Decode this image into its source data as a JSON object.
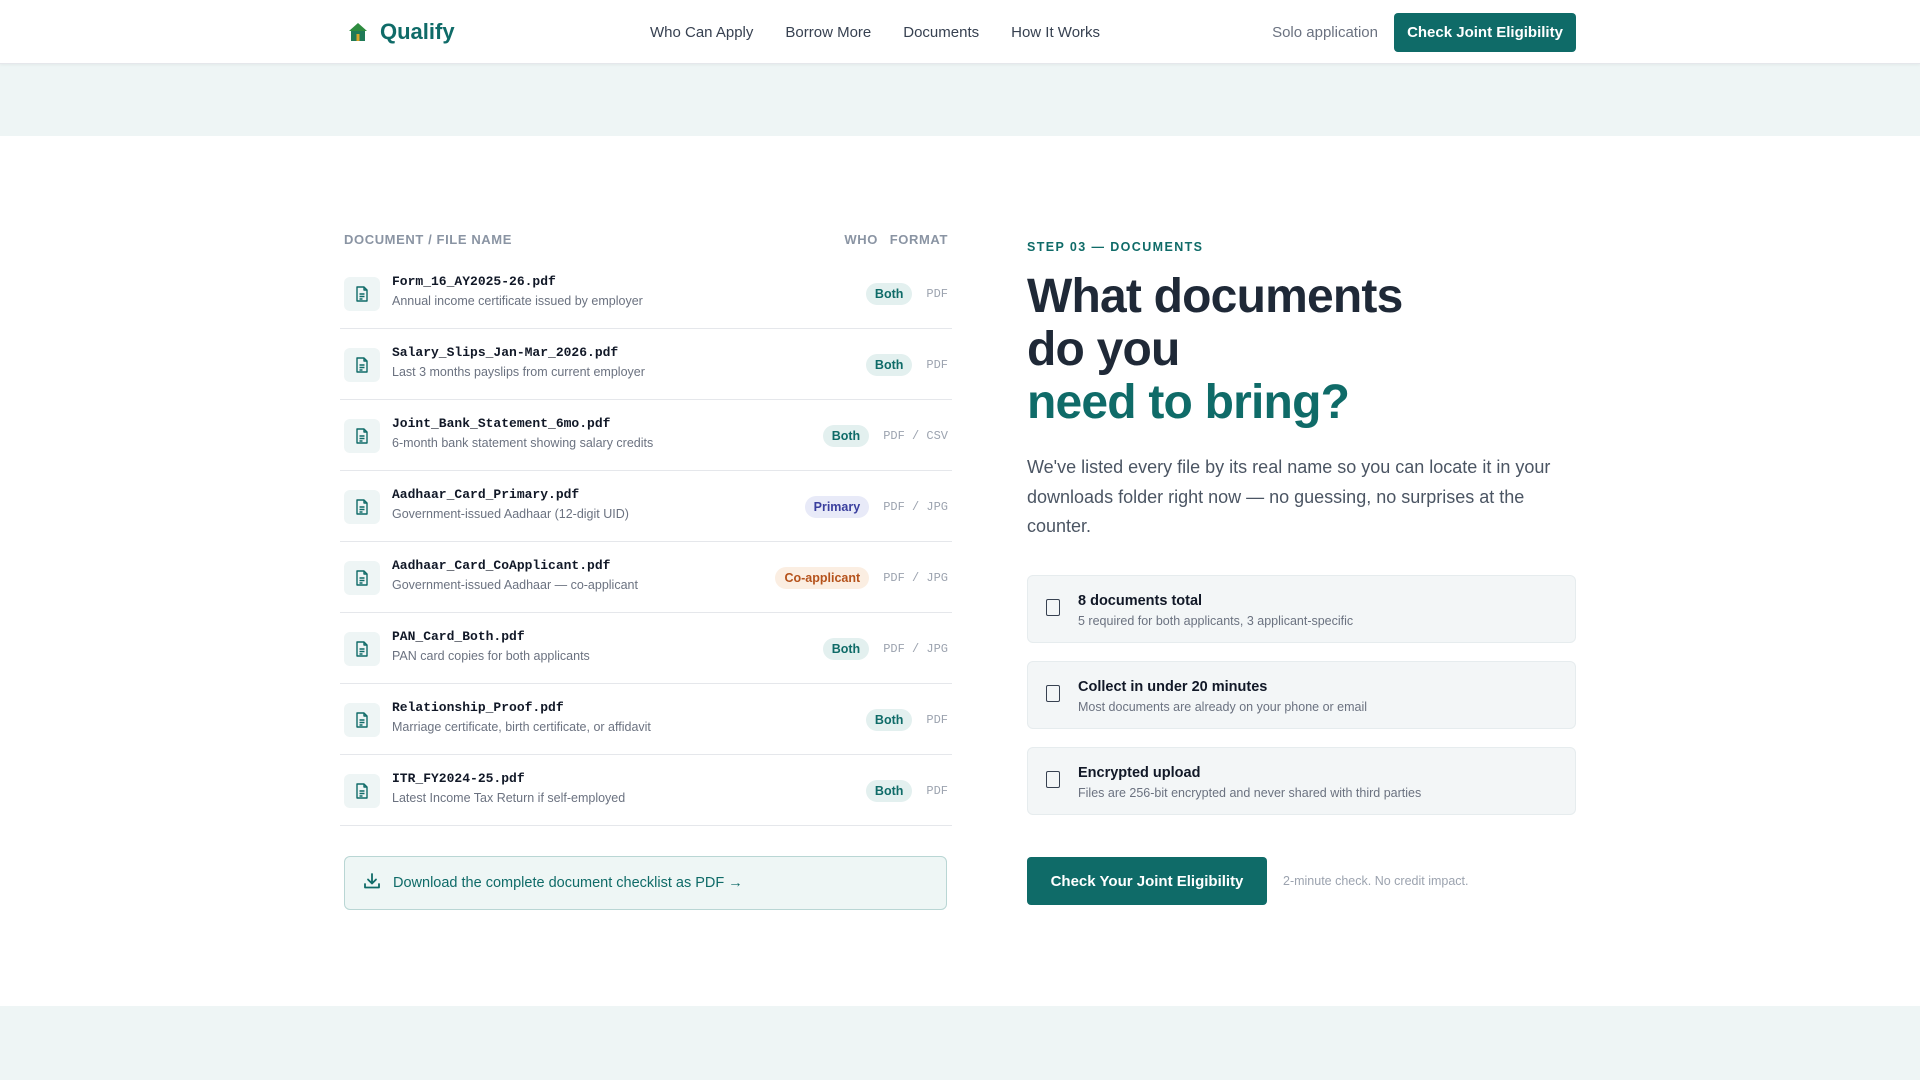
{
  "nav": {
    "brand": "Qualify",
    "links": [
      "Who Can Apply",
      "Borrow More",
      "Documents",
      "How It Works"
    ],
    "solo": "Solo application",
    "cta": "Check Joint Eligibility"
  },
  "table": {
    "headers": {
      "doc": "DOCUMENT / FILE NAME",
      "who": "WHO",
      "format": "FORMAT"
    },
    "rows": [
      {
        "file": "Form_16_AY2025-26.pdf",
        "desc": "Annual income certificate issued by employer",
        "who": "Both",
        "format": "PDF"
      },
      {
        "file": "Salary_Slips_Jan-Mar_2026.pdf",
        "desc": "Last 3 months payslips from current employer",
        "who": "Both",
        "format": "PDF"
      },
      {
        "file": "Joint_Bank_Statement_6mo.pdf",
        "desc": "6-month bank statement showing salary credits",
        "who": "Both",
        "format": "PDF / CSV"
      },
      {
        "file": "Aadhaar_Card_Primary.pdf",
        "desc": "Government-issued Aadhaar (12-digit UID)",
        "who": "Primary",
        "format": "PDF / JPG"
      },
      {
        "file": "Aadhaar_Card_CoApplicant.pdf",
        "desc": "Government-issued Aadhaar — co-applicant",
        "who": "Co-applicant",
        "format": "PDF / JPG"
      },
      {
        "file": "PAN_Card_Both.pdf",
        "desc": "PAN card copies for both applicants",
        "who": "Both",
        "format": "PDF / JPG"
      },
      {
        "file": "Relationship_Proof.pdf",
        "desc": "Marriage certificate, birth certificate, or affidavit",
        "who": "Both",
        "format": "PDF"
      },
      {
        "file": "ITR_FY2024-25.pdf",
        "desc": "Latest Income Tax Return if self-employed",
        "who": "Both",
        "format": "PDF"
      }
    ],
    "download": "Download the complete document checklist as PDF →"
  },
  "hero": {
    "eyebrow": "STEP 03 — DOCUMENTS",
    "line1": "What documents",
    "line2": "do you",
    "line3": "need to bring?",
    "lead": "We've listed every file by its real name so you can locate it in your downloads folder right now — no guessing, no surprises at the counter."
  },
  "features": [
    {
      "title": "8 documents total",
      "desc": "5 required for both applicants, 3 applicant-specific"
    },
    {
      "title": "Collect in under 20 minutes",
      "desc": "Most documents are already on your phone or email"
    },
    {
      "title": "Encrypted upload",
      "desc": "Files are 256-bit encrypted and never shared with third parties"
    }
  ],
  "cta": {
    "label": "Check Your Joint Eligibility",
    "note": "2-minute check. No credit impact."
  },
  "colors": {
    "accent": "#0f6b68",
    "band": "#eef5f5"
  },
  "icons": {
    "brand": "house-icon",
    "document": "document-icon",
    "download": "download-icon",
    "checkbox": "checkbox-icon"
  }
}
